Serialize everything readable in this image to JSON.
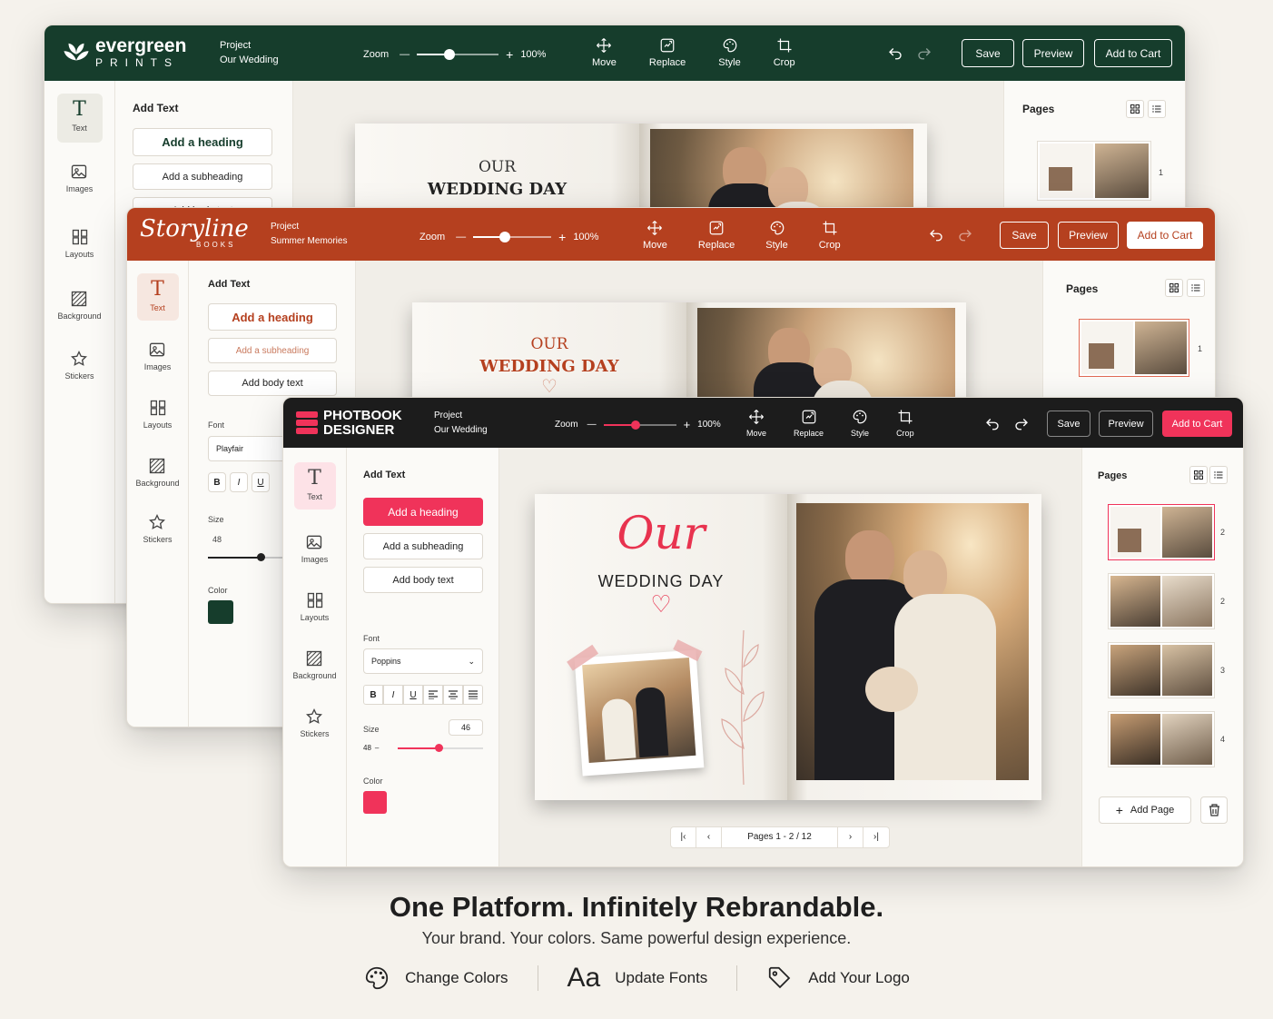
{
  "evergreen": {
    "brand_top": "evergreen",
    "brand_bottom": "PRINTS",
    "project_label": "Project",
    "project_name": "Our Wedding",
    "zoom_label": "Zoom",
    "zoom_value": "100%",
    "zoom_level_percent": 40,
    "tools": [
      "Move",
      "Replace",
      "Style",
      "Crop"
    ],
    "save": "Save",
    "preview": "Preview",
    "add_to_cart": "Add to Cart",
    "sidebar": [
      "Text",
      "Images",
      "Layouts",
      "Background",
      "Stickers"
    ],
    "panel_title": "Add Text",
    "add_heading": "Add a heading",
    "add_subheading": "Add a subheading",
    "add_body": "Add body text",
    "pages_title": "Pages",
    "page_number": "1",
    "book_line1": "OUR",
    "book_line2": "WEDDING DAY",
    "color_primary": "#163d2c"
  },
  "storyline": {
    "brand_top": "Storyline",
    "brand_bottom": "BOOKS",
    "project_label": "Project",
    "project_name": "Summer Memories",
    "zoom_label": "Zoom",
    "zoom_value": "100%",
    "zoom_level_percent": 40,
    "tools": [
      "Move",
      "Replace",
      "Style",
      "Crop"
    ],
    "save": "Save",
    "preview": "Preview",
    "add_to_cart": "Add to Cart",
    "sidebar": [
      "Text",
      "Images",
      "Layouts",
      "Background",
      "Stickers"
    ],
    "panel_title": "Add Text",
    "add_heading": "Add a heading",
    "add_subheading": "Add a subheading",
    "add_body": "Add body text",
    "font_label": "Font",
    "font_value": "Playfair",
    "format_buttons": [
      "B",
      "I",
      "U"
    ],
    "size_label": "Size",
    "size_value": "48",
    "size_level_percent": 60,
    "color_label": "Color",
    "pages_title": "Pages",
    "page_number": "1",
    "book_line1": "OUR",
    "book_line2": "WEDDING DAY",
    "color_primary": "#b5401f"
  },
  "photobook": {
    "brand_top": "PHOTBOOK",
    "brand_bottom": "DESIGNER",
    "project_label": "Project",
    "project_name": "Our Wedding",
    "zoom_label": "Zoom",
    "zoom_value": "100%",
    "zoom_level_percent": 45,
    "tools": [
      "Move",
      "Replace",
      "Style",
      "Crop"
    ],
    "save": "Save",
    "preview": "Preview",
    "add_to_cart": "Add to Cart",
    "sidebar": [
      "Text",
      "Images",
      "Layouts",
      "Background",
      "Stickers"
    ],
    "panel_title": "Add Text",
    "add_heading": "Add a heading",
    "add_subheading": "Add a subheading",
    "add_body": "Add body text",
    "font_label": "Font",
    "font_value": "Poppins",
    "format_buttons": [
      "B",
      "I",
      "U"
    ],
    "size_label": "Size",
    "size_value": "46",
    "size_input": "48",
    "size_level_percent": 50,
    "color_label": "Color",
    "pages_title": "Pages",
    "page_numbers": [
      "2",
      "2",
      "3",
      "4"
    ],
    "add_page": "Add Page",
    "pagination": "Pages 1 - 2 / 12",
    "book_script": "Our",
    "book_title": "WEDDING DAY",
    "color_primary": "#f0335a",
    "color_dark": "#1c1c1c"
  },
  "marketing": {
    "headline": "One Platform. Infinitely Rebrandable.",
    "subheadline": "Your brand. Your colors. Same powerful design experience.",
    "features": [
      {
        "icon": "palette-icon",
        "label": "Change Colors"
      },
      {
        "icon": "font-aa-icon",
        "glyph": "Aa",
        "label": "Update Fonts"
      },
      {
        "icon": "tag-icon",
        "label": "Add Your Logo"
      }
    ]
  }
}
